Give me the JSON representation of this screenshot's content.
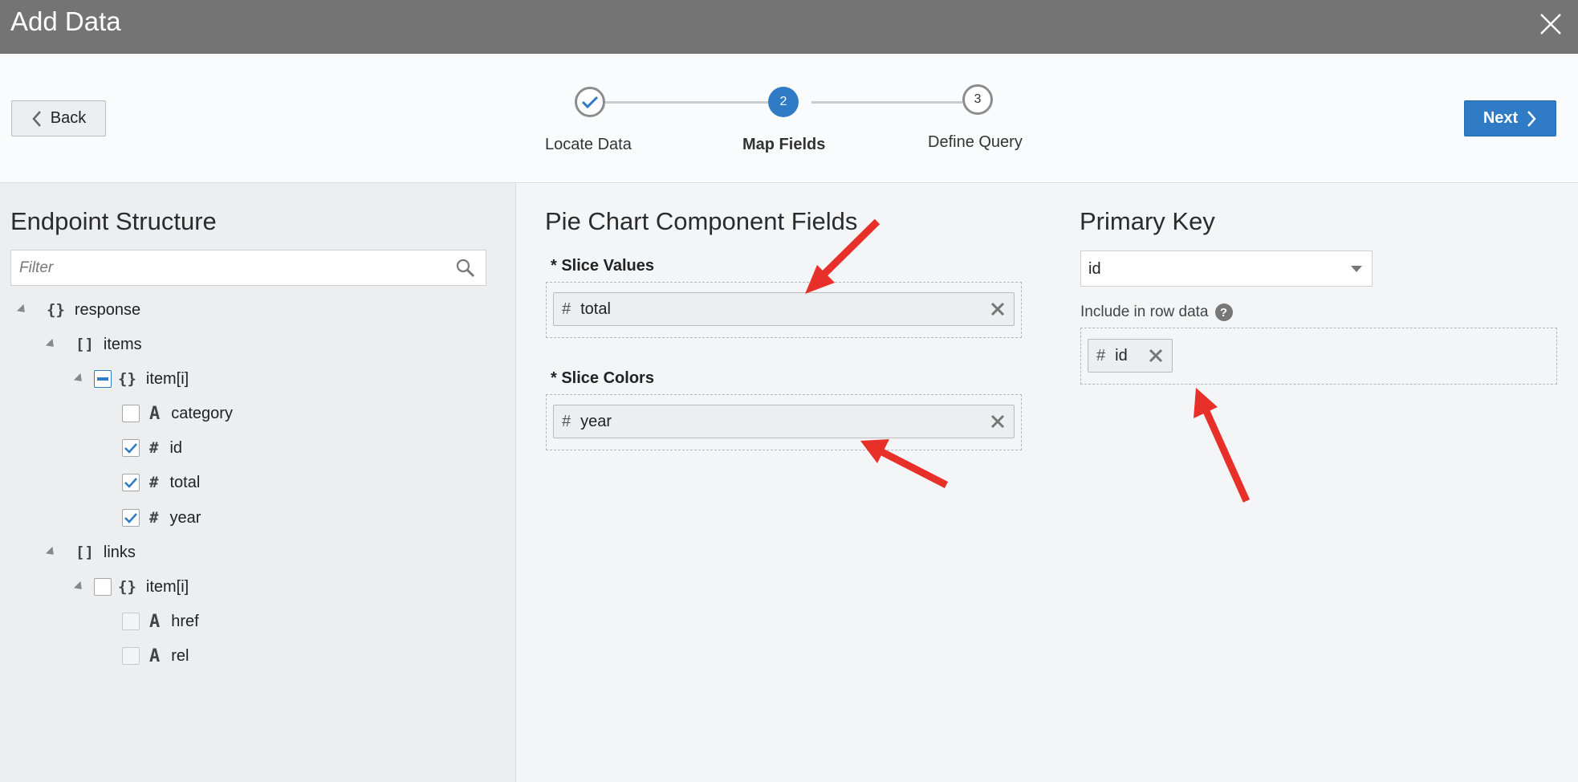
{
  "dialog": {
    "title": "Add Data",
    "close_icon": "close-icon"
  },
  "nav": {
    "back_label": "Back",
    "next_label": "Next"
  },
  "steps": [
    {
      "number": "",
      "label": "Locate Data",
      "state": "done"
    },
    {
      "number": "2",
      "label": "Map Fields",
      "state": "active"
    },
    {
      "number": "3",
      "label": "Define Query",
      "state": "todo"
    }
  ],
  "left": {
    "heading": "Endpoint Structure",
    "filter_placeholder": "Filter",
    "tree": {
      "response": "response",
      "items": "items",
      "items_item": "item[i]",
      "category": "category",
      "id": "id",
      "total": "total",
      "year": "year",
      "links": "links",
      "links_item": "item[i]",
      "href": "href",
      "rel": "rel"
    },
    "glyphs": {
      "object": "{}",
      "array": "[]",
      "text": "A",
      "number": "#"
    }
  },
  "fields": {
    "heading": "Pie Chart Component Fields",
    "slice_values_label": "* Slice Values",
    "slice_values_chip": "total",
    "slice_colors_label": "* Slice Colors",
    "slice_colors_chip": "year"
  },
  "primary": {
    "heading": "Primary Key",
    "select_value": "id",
    "include_label": "Include in row data",
    "include_help": "?",
    "include_chip": "id"
  },
  "colors": {
    "accent": "#2f7bc6",
    "titlebar": "#747474",
    "annotation": "#e8302a"
  }
}
